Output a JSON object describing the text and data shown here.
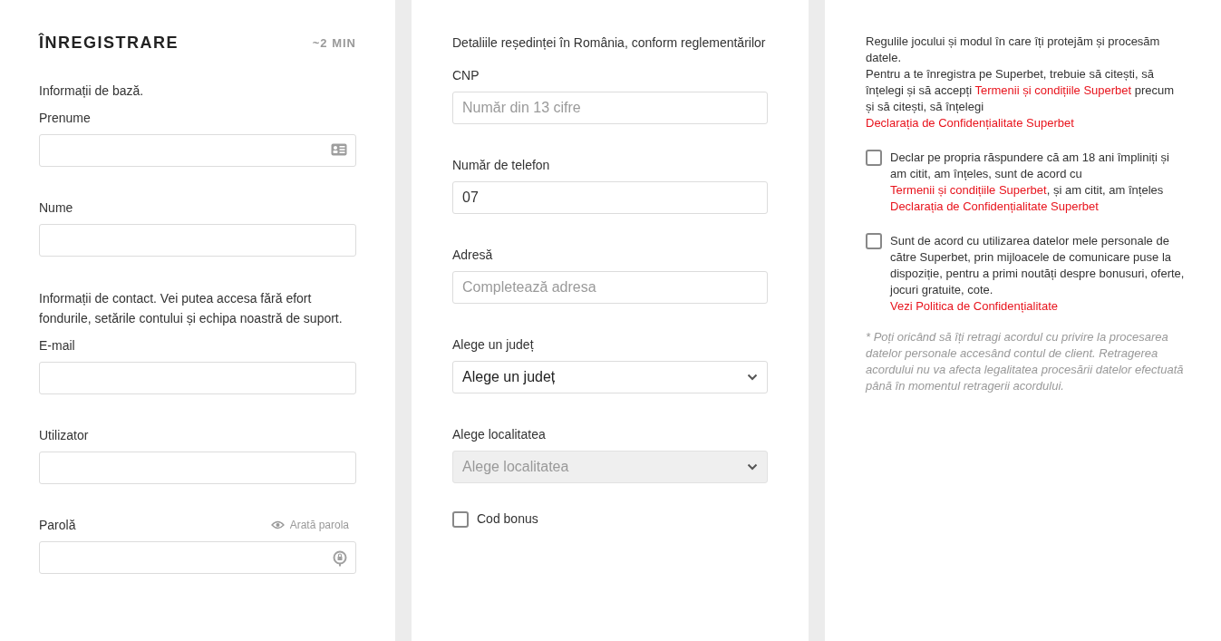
{
  "header": {
    "title": "ÎNREGISTRARE",
    "duration": "~2 MIN"
  },
  "left": [
    {
      "kind": "note",
      "text": "Informații de bază."
    },
    {
      "kind": "card_field",
      "label": "Prenume"
    },
    {
      "kind": "field",
      "label": "Nume"
    },
    {
      "kind": "note",
      "text": "Informații de contact. Vei putea accesa fără efort fondurile, setările contului și echipa noastră de suport."
    },
    {
      "kind": "field",
      "label": "E-mail"
    },
    {
      "kind": "field",
      "label": "Utilizator"
    },
    {
      "kind": "password",
      "label": "Parolă",
      "toggle": "Arată parola"
    }
  ],
  "middle": {
    "intro": "Detaliile reședinței în România, conform reglementărilor",
    "fields": [
      {
        "kind": "field",
        "label": "CNP",
        "placeholder": "Număr din 13 cifre"
      },
      {
        "kind": "field",
        "label": "Număr de telefon",
        "value": "07"
      },
      {
        "kind": "field",
        "label": "Adresă",
        "placeholder": "Completează adresa"
      },
      {
        "kind": "select",
        "label": "Alege un județ",
        "value": "Alege un județ",
        "disabled": false
      },
      {
        "kind": "select",
        "label": "Alege localitatea",
        "placeholder": "Alege localitatea",
        "disabled": true
      }
    ],
    "bonus": {
      "label": "Cod bonus",
      "checked": false
    }
  },
  "right": {
    "intro": [
      [
        {
          "kind": "text",
          "text": "Regulile jocului și modul în care îți protejăm și procesăm datele."
        }
      ],
      [
        {
          "kind": "text",
          "text": "Pentru a te înregistra pe Superbet, trebuie să citești, să înțelegi și să accepți "
        },
        {
          "kind": "link",
          "text": "Termenii și condițiile Superbet"
        },
        {
          "kind": "text",
          "text": " precum și să citești, să înțelegi"
        }
      ],
      [
        {
          "kind": "link",
          "text": "Declarația de Confidențialitate Superbet"
        }
      ]
    ],
    "consents": [
      {
        "checked": false,
        "paragraphs": [
          [
            {
              "kind": "text",
              "text": "Declar pe propria răspundere că am 18 ani împliniți și am citit, am înțeles, sunt de acord cu "
            },
            {
              "kind": "link",
              "text": "Termenii și condițiile Superbet"
            },
            {
              "kind": "text",
              "text": ", și am citit, am înțeles "
            },
            {
              "kind": "link",
              "text": "Declarația de Confidențialitate Superbet"
            }
          ]
        ]
      },
      {
        "checked": false,
        "paragraphs": [
          [
            {
              "kind": "text",
              "text": "Sunt de acord cu utilizarea datelor mele personale de către Superbet, prin mijloacele de comunicare puse la dispoziție, pentru a primi noutăți despre bonusuri, oferte, jocuri gratuite, cote."
            }
          ],
          [
            {
              "kind": "link",
              "text": "Vezi Politica de Confidențialitate"
            }
          ]
        ]
      }
    ],
    "footnote": "* Poți oricând să îți retragi acordul cu privire la procesarea datelor personale accesând contul de client. Retragerea acordului nu va afecta legalitatea procesării datelor efectuată până în momentul retragerii acordului."
  }
}
